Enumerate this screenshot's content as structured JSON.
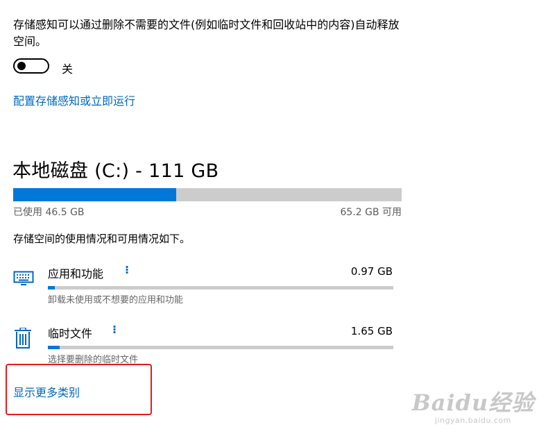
{
  "storage_sense": {
    "description": "存储感知可以通过删除不需要的文件(例如临时文件和回收站中的内容)自动释放空间。",
    "toggle_state": "关",
    "toggle_on": false,
    "configure_link": "配置存储感知或立即运行"
  },
  "disk": {
    "title": "本地磁盘 (C:) - 111 GB",
    "used_label": "已使用 46.5 GB",
    "free_label": "65.2 GB 可用",
    "used_fraction": 0.4189,
    "intro": "存储空间的使用情况和可用情况如下。"
  },
  "categories": [
    {
      "name": "应用和功能",
      "size": "0.97 GB",
      "description": "卸载未使用或不想要的应用和功能",
      "icon": "keyboard-icon",
      "fraction": 0.02
    },
    {
      "name": "临时文件",
      "size": "1.65 GB",
      "description": "选择要删除的临时文件",
      "icon": "trash-icon",
      "fraction": 0.035
    }
  ],
  "show_more_link": "显示更多类别",
  "watermark": {
    "main": "Baidu经验",
    "sub": "jingyan.baidu.com"
  },
  "colors": {
    "accent": "#0078d7",
    "link": "#0067c0",
    "bar_background": "#cccccc",
    "highlight_box": "#e81a1a"
  }
}
